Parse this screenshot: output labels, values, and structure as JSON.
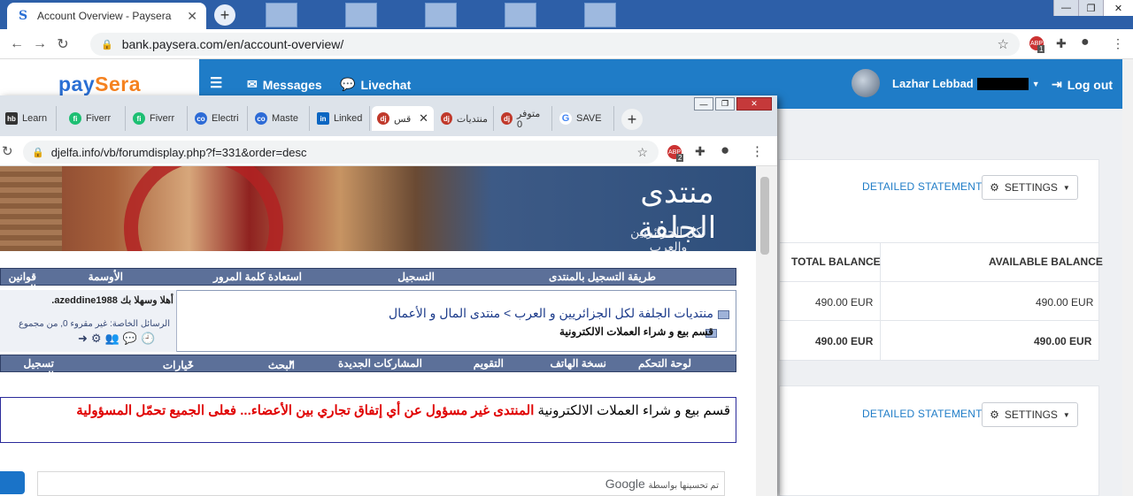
{
  "back_window": {
    "tab_title": "Account Overview - Paysera",
    "url": "bank.paysera.com/en/account-overview/",
    "logo_pay": "pay",
    "logo_sera": "Sera",
    "nav": {
      "menu_icon": "hamburger-icon",
      "messages": "Messages",
      "livechat": "Livechat",
      "user": "Lazhar Lebbad",
      "logout": "Log out"
    },
    "card1": {
      "detailed": "DETAILED STATEMENT",
      "settings": "SETTINGS",
      "col_total": "TOTAL BALANCE",
      "col_available": "AVAILABLE BALANCE",
      "row1_total": "490.00 EUR",
      "row1_available": "490.00 EUR",
      "row2_total": "490.00 EUR",
      "row2_available": "490.00 EUR"
    },
    "card2": {
      "detailed": "DETAILED STATEMENT",
      "settings": "SETTINGS"
    },
    "ext_badge": "1"
  },
  "front_window": {
    "tabs": [
      {
        "label": "Learn",
        "icon": "hb"
      },
      {
        "label": "Fiverr",
        "icon": "fi"
      },
      {
        "label": "Fiverr",
        "icon": "fi"
      },
      {
        "label": "Electri",
        "icon": "co"
      },
      {
        "label": "Maste",
        "icon": "co"
      },
      {
        "label": "Linked",
        "icon": "in"
      },
      {
        "label": "قس",
        "icon": "dj"
      },
      {
        "label": "منتديات",
        "icon": "dj"
      },
      {
        "label": "متوفر 0",
        "icon": "dj"
      },
      {
        "label": "SAVE",
        "icon": "G"
      }
    ],
    "url": "djelfa.info/vb/forumdisplay.php?f=331&order=desc",
    "ext_badge": "2",
    "banner_title": "منتدى الجلفة",
    "banner_sub": "لكل الجزائريين والعرب",
    "top_nav": [
      "طريقة التسجيل بالمنتدى",
      "التسجيل",
      "استعادة كلمة المرور",
      "الأوسمة",
      "قوانين الم"
    ],
    "hello": "أهلا وسهلا بك azeddine1988.",
    "pm": "الرسائل الخاصة: غير مقروء 0, من مجموع",
    "breadcrumb": "منتديات الجلفة لكل الجزائريين و العرب > منتدى المال و الأعمال",
    "forum_title": "قسم بيع و شراء العملات الالكترونية",
    "sub_nav": [
      "لوحة التحكم",
      "نسخة الهاتف",
      "التقويم",
      "المشاركات الجديدة",
      "البحث",
      "خيارات سريعة",
      "تسجيل الخرو"
    ],
    "notice_plain": "قسم بيع و شراء العملات الالكترونية",
    "notice_red": "المنتدى غير مسؤول عن أي إتفاق تجاري بين الأعضاء... فعلى الجميع تحمّل المسؤولية",
    "search_label": "تم تحسينها بواسطة",
    "search_brand": "Google"
  }
}
